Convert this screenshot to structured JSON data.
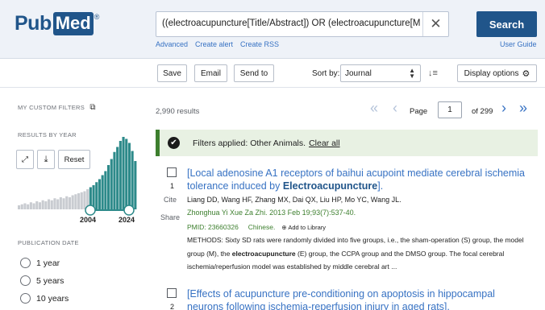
{
  "header": {
    "logo_pub": "Pub",
    "logo_med": "Med",
    "logo_reg": "®",
    "search_query": "((electroacupuncture[Title/Abstract]) OR (electroacupuncture[MeSH Terms]))",
    "clear_icon": "close-icon",
    "search_label": "Search",
    "advanced": "Advanced",
    "create_alert": "Create alert",
    "create_rss": "Create RSS",
    "user_guide": "User Guide",
    "brand_color": "#20558a"
  },
  "toolbar": {
    "save": "Save",
    "email": "Email",
    "send_to": "Send to",
    "sort_by_label": "Sort by:",
    "sort_value": "Journal",
    "display_options": "Display options"
  },
  "sidebar": {
    "my_custom_filters": "MY CUSTOM FILTERS",
    "results_by_year": "RESULTS BY YEAR",
    "reset": "Reset",
    "year_start": "2004",
    "year_end": "2024",
    "publication_date": "PUBLICATION DATE",
    "date_options": [
      "1 year",
      "5 years",
      "10 years"
    ]
  },
  "results": {
    "count": "2,990 results",
    "page_label": "Page",
    "page_value": "1",
    "page_of": "of 299",
    "filter_text": "Filters applied: Other Animals.",
    "filter_clear": "Clear all",
    "cite": "Cite",
    "share": "Share",
    "items": [
      {
        "number": "1",
        "title_pre": "[Local adenosine A1 receptors of baihui acupoint mediate cerebral ischemia tolerance induced by ",
        "title_bold": "Electroacupuncture",
        "title_post": "].",
        "authors": "Liang DD, Wang HF, Zhang MX, Dai QX, Liu HP, Mo YC, Wang JL.",
        "journal": "Zhonghua Yi Xue Za Zhi. 2013 Feb 19;93(7):537-40.",
        "pmid": "PMID: 23660326",
        "language": "Chinese.",
        "add_to_library": "Add to Library",
        "abstract_a": "METHODS: Sixty SD rats were randomly divided into five groups, i.e., the sham-operation (S) group, the model group (M), the ",
        "abstract_bold": "electroacupuncture",
        "abstract_b": " (E) group, the CCPA group and the DMSO group. The focal cerebral ischemia/reperfusion model was established by middle cerebral art ..."
      },
      {
        "number": "2",
        "title": "[Effects of acupuncture pre-conditioning on apoptosis in hippocampal neurons following ischemia-reperfusion injury in aged rats]."
      }
    ]
  },
  "chart_data": {
    "type": "bar",
    "title": "RESULTS BY YEAR",
    "x_range_labels": [
      "2004",
      "2024"
    ],
    "series": [
      {
        "values": [
          4,
          5,
          6,
          5,
          7,
          6,
          8,
          7,
          9,
          8,
          10,
          9,
          11,
          10,
          12,
          11,
          13,
          12,
          14,
          15,
          16,
          17,
          18,
          20,
          22,
          24,
          27,
          30,
          34,
          38,
          44,
          50,
          57,
          62,
          68,
          72,
          70,
          66,
          58,
          48
        ]
      }
    ],
    "highlight_color": "#2d8a8a",
    "base_color": "#c9ccd1"
  }
}
